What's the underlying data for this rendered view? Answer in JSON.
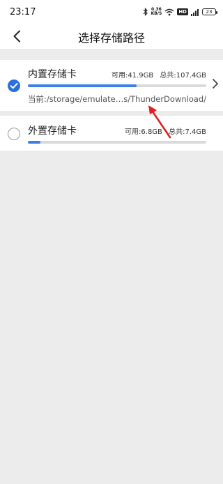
{
  "status_bar": {
    "time": "23:17",
    "net_speed_value": "0.36",
    "net_speed_unit": "KB/S",
    "hd_label": "HD",
    "battery": "23"
  },
  "header": {
    "title": "选择存储路径",
    "back_icon": "chevron-left-icon"
  },
  "storage": {
    "internal": {
      "name": "内置存储卡",
      "available": "可用:41.9GB",
      "total": "总共:107.4GB",
      "used_fraction": 0.61,
      "path": "当前:/storage/emulate…s/ThunderDownload/",
      "selected": true
    },
    "external": {
      "name": "外置存储卡",
      "available": "可用:6.8GB",
      "total": "总共:7.4GB",
      "used_fraction": 0.07,
      "selected": false
    }
  },
  "colors": {
    "accent": "#2a6fe0",
    "bar_fill": "#3d7fe6",
    "annotation_arrow": "#e02020"
  }
}
